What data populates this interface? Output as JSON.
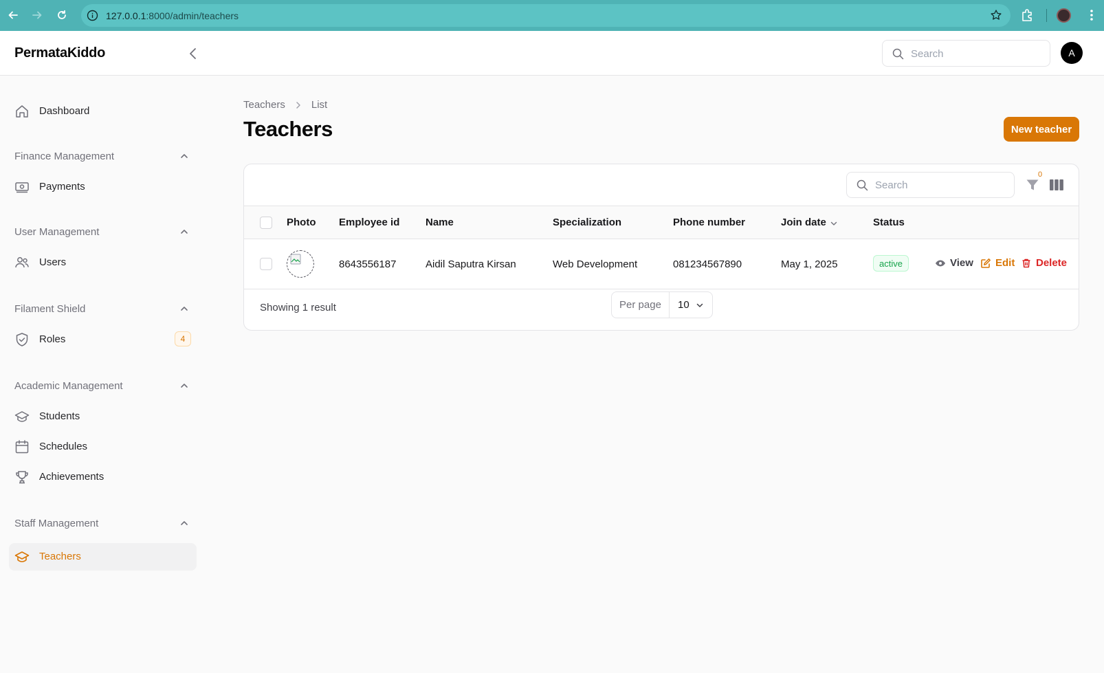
{
  "browser": {
    "url_host": "127.0.0.1",
    "url_path": ":8000/admin/teachers"
  },
  "app": {
    "brand": "PermataKiddo",
    "search_placeholder": "Search",
    "avatar_initial": "A"
  },
  "sidebar": {
    "dashboard": "Dashboard",
    "groups": {
      "finance": {
        "label": "Finance Management",
        "items": {
          "payments": "Payments"
        }
      },
      "user": {
        "label": "User Management",
        "items": {
          "users": "Users"
        }
      },
      "shield": {
        "label": "Filament Shield",
        "items": {
          "roles": "Roles",
          "roles_badge": "4"
        }
      },
      "academic": {
        "label": "Academic Management",
        "items": {
          "students": "Students",
          "schedules": "Schedules",
          "achievements": "Achievements"
        }
      },
      "staff": {
        "label": "Staff Management",
        "items": {
          "teachers": "Teachers"
        }
      }
    }
  },
  "page": {
    "breadcrumb": [
      "Teachers",
      "List"
    ],
    "title": "Teachers",
    "new_button": "New teacher"
  },
  "table": {
    "search_placeholder": "Search",
    "filter_count": "0",
    "columns": [
      "Photo",
      "Employee id",
      "Name",
      "Specialization",
      "Phone number",
      "Join date",
      "Status"
    ],
    "rows": [
      {
        "employee_id": "8643556187",
        "name": "Aidil Saputra Kirsan",
        "specialization": "Web Development",
        "phone": "081234567890",
        "join_date": "May 1, 2025",
        "status": "active"
      }
    ],
    "actions": {
      "view": "View",
      "edit": "Edit",
      "delete": "Delete"
    },
    "footer": {
      "showing": "Showing 1 result",
      "per_page_label": "Per page",
      "per_page_value": "10"
    }
  },
  "colors": {
    "accent": "#d97706",
    "browser_bar": "#4fb3b5",
    "danger": "#dc2626",
    "success": "#16a34a"
  }
}
